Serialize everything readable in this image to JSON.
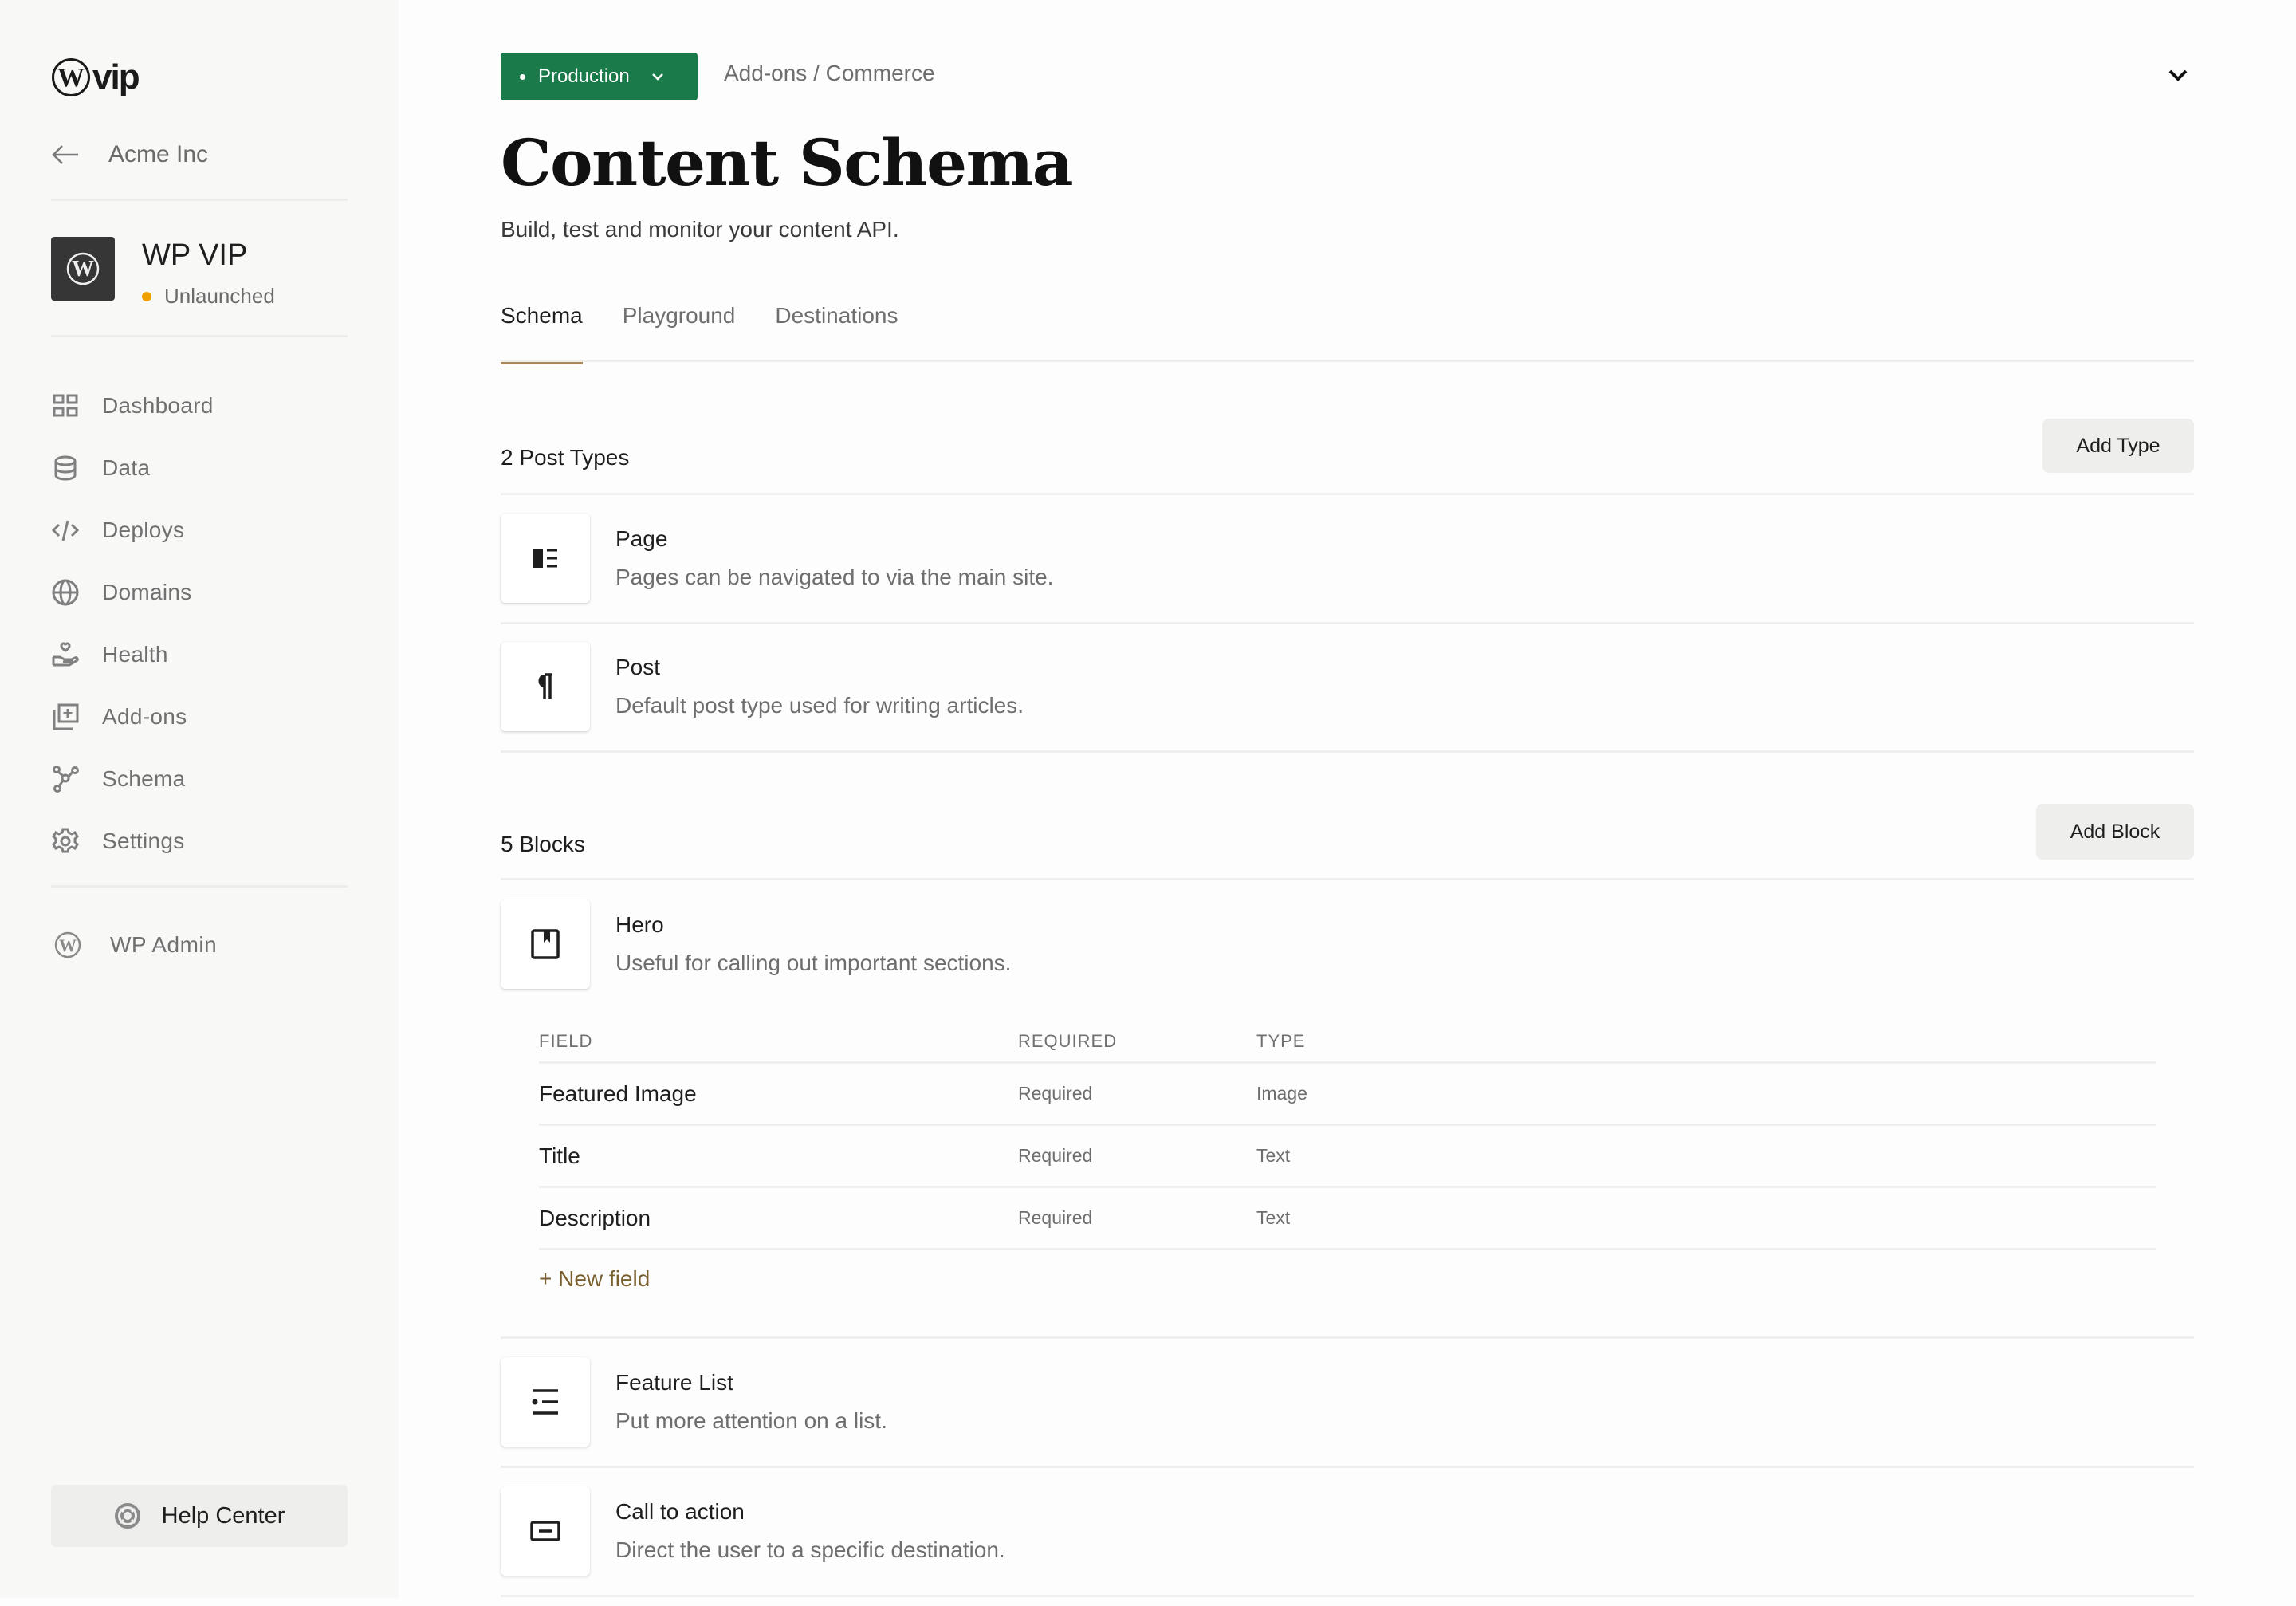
{
  "sidebar": {
    "logo_text": "vip",
    "back_label": "Acme Inc",
    "site": {
      "name": "WP VIP",
      "status": "Unlaunched",
      "status_color": "#f0a100"
    },
    "nav": [
      {
        "label": "Dashboard",
        "icon": "grid-icon"
      },
      {
        "label": "Data",
        "icon": "database-icon"
      },
      {
        "label": "Deploys",
        "icon": "code-icon"
      },
      {
        "label": "Domains",
        "icon": "globe-icon"
      },
      {
        "label": "Health",
        "icon": "hand-heart-icon"
      },
      {
        "label": "Add-ons",
        "icon": "add-stack-icon"
      },
      {
        "label": "Schema",
        "icon": "nodes-icon"
      },
      {
        "label": "Settings",
        "icon": "gear-icon"
      }
    ],
    "wp_admin_label": "WP Admin",
    "help_label": "Help Center"
  },
  "header": {
    "environment": "Production",
    "environment_color": "#1b7a4a",
    "breadcrumb": "Add-ons / Commerce",
    "title": "Content Schema",
    "subtitle": "Build, test and monitor your content API."
  },
  "tabs": [
    {
      "label": "Schema",
      "active": true
    },
    {
      "label": "Playground",
      "active": false
    },
    {
      "label": "Destinations",
      "active": false
    }
  ],
  "post_types": {
    "heading": "2 Post Types",
    "button": "Add Type",
    "items": [
      {
        "name": "Page",
        "description": "Pages can be navigated to via the main site.",
        "icon": "page-layout-icon"
      },
      {
        "name": "Post",
        "description": "Default post type used for writing articles.",
        "icon": "pilcrow-icon"
      }
    ]
  },
  "blocks": {
    "heading": "5 Blocks",
    "button": "Add Block",
    "items": [
      {
        "name": "Hero",
        "description": "Useful for calling out important sections.",
        "icon": "bookmark-card-icon"
      },
      {
        "name": "Feature List",
        "description": "Put more attention on a list.",
        "icon": "bullet-list-icon"
      },
      {
        "name": "Call to action",
        "description": "Direct the user to a specific destination.",
        "icon": "button-icon"
      }
    ],
    "hero_fields": {
      "columns": [
        "FIELD",
        "REQUIRED",
        "TYPE"
      ],
      "rows": [
        {
          "field": "Featured Image",
          "required": "Required",
          "type": "Image"
        },
        {
          "field": "Title",
          "required": "Required",
          "type": "Text"
        },
        {
          "field": "Description",
          "required": "Required",
          "type": "Text"
        }
      ],
      "new_field_label": "+ New field"
    }
  },
  "accent_color": "#a8875a"
}
